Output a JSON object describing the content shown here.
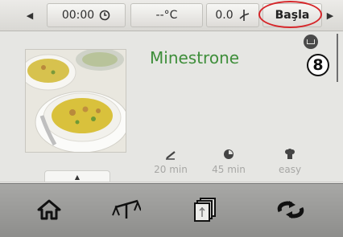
{
  "topbar": {
    "time": "00:00",
    "temperature": "--°C",
    "speed": "0.0",
    "start_label": "Başla"
  },
  "recipe": {
    "title": "Minestrone",
    "step_badge": "8",
    "prep_time": "20 min",
    "total_time": "45 min",
    "difficulty": "easy"
  },
  "icons": {
    "left_arrow": "chevron-left-icon",
    "right_arrow": "chevron-right-icon",
    "clock": "clock-icon",
    "fan": "speed-icon",
    "book": "recipe-book-icon",
    "knife": "preparation-icon",
    "timer": "total-time-icon",
    "chef": "difficulty-icon",
    "home": "home-icon",
    "scale": "scale-icon",
    "cards": "recipe-cards-icon",
    "turbo": "turbo-icon",
    "handle": "chevron-up-icon"
  },
  "colors": {
    "title_green": "#3e8e3a",
    "highlight_red": "#d6262a",
    "meta_gray": "#a7a7a5"
  }
}
